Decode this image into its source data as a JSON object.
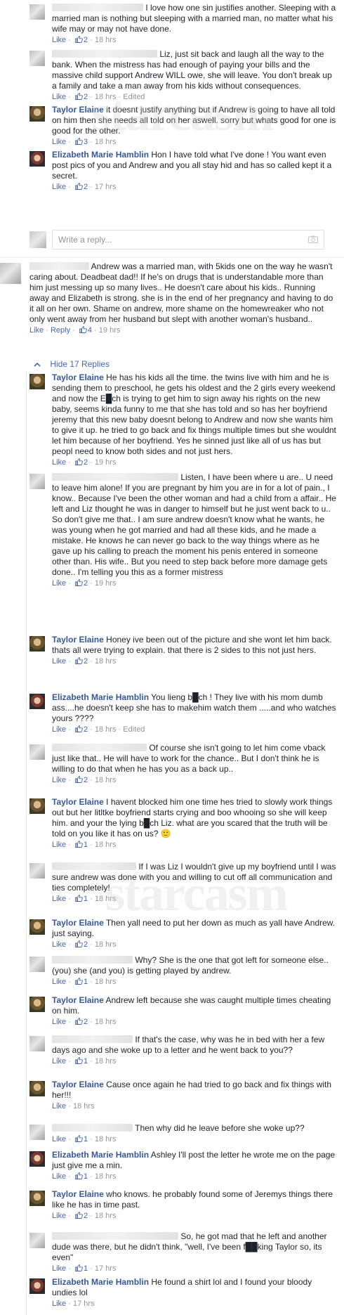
{
  "ui": {
    "like_label": "Like",
    "reply_label": "Reply",
    "edited_label": "Edited",
    "reply_placeholder": "Write a reply...",
    "hide_replies_label": "Hide 17 Replies",
    "watermark": "starcasm",
    "like_color": "#4267b2",
    "name_color": "#365899"
  },
  "comments": [
    {
      "author": "",
      "text": "I love how one sin justifies another. Sleeping with a married man is nothing but sleeping with a married man, no matter what his wife may or may not have done.",
      "likes": "2",
      "time": "18 hrs",
      "edited": false
    },
    {
      "author": "",
      "text": "Liz, just sit back and laugh all the way to the bank. When the mistress has had enough of paying your bills and the massive child support Andrew WILL owe, she will leave. You don't break up a family and take a man away from his kids without consequences.",
      "likes": "2",
      "time": "18 hrs",
      "edited": true
    },
    {
      "author": "Taylor Elaine",
      "text": "it doesnt justify anything but if Andrew is going to have all told on him then she needs all told on her aswell. sorry but whats good for one is good for the other.",
      "likes": "3",
      "time": "18 hrs",
      "edited": false
    },
    {
      "author": "Elizabeth Marie Hamblin",
      "text": "Hon I have told what I've done ! You want even post pics of you and Andrew and you all stay hid and has so called kept it a secret.",
      "likes": "2",
      "time": "17 hrs",
      "edited": false
    },
    {
      "author": "",
      "text": "Andrew was a married man, with 5kids one on the way he wasn't caring about. Deadbeat dad!! If he's on drugs that is understandable more than him just messing up so many lives.. He doesn't care about his kids.. Running away and Elizabeth is strong. she is in the end of her pregnancy and having to do it all on her own. Shame on andrew, more shame on the homewreaker who not only went away from her husband but slept with another woman's husband..",
      "likes": "4",
      "time": "19 hrs",
      "edited": false
    },
    {
      "author": "Taylor Elaine",
      "text": "He has his kids all the time. the twins live with him and he is sending them to preschool, he gets his oldest and the 2 girls every weekend and now the E█ch is trying to get him to sign away his rights on the new baby, seems kinda funny to me that she has told and so has her boyfriend jeremy that this new baby doesnt belong to Andrew and now she wants him to give it up. he tried to go back and fix things multiple times but she wouldnt let him because of her boyfriend. Yes he sinned just like all of us has but peopl need to know both sides and not just hers.",
      "likes": "2",
      "time": "19 hrs",
      "edited": false
    },
    {
      "author": "",
      "text": "Listen, I have been where u are.. U need to leave him alone! If you are pregnant by him you are in for a lot of pain., I know.. Because I've been the other woman and had a child from a affair.. He left and Liz thought he was in danger to himself but he just went back to u.. So don't give me that.. I am sure andrew doesn't know what he wants, he was young when he got married and had all these kids, and he made a mistake. He knows he can never go back to the way things where as he gave up his calling to preach the moment his penis entered in someone other than. His wife.. But you need to step back before more damage gets done.. I'm telling you this as a former mistress",
      "likes": "2",
      "time": "19 hrs",
      "edited": false
    },
    {
      "author": "Taylor Elaine",
      "text": "Honey ive been out of the picture and she wont let him back. thats all were trying to explain. that there is 2 sides to this not just hers.",
      "likes": "2",
      "time": "18 hrs",
      "edited": false
    },
    {
      "author": "Elizabeth Marie Hamblin",
      "text": "You lieng b█ch ! They live with his mom dumb ass....he doesn't keep she has to makehim watch them .....and who watches yours ????",
      "likes": "2",
      "time": "18 hrs",
      "edited": true
    },
    {
      "author": "",
      "text": "Of course she isn't going to let him come vback just like that.. He will have to work for the chance.. But I don't think he is willing to do that when he has you as a back up..",
      "likes": "2",
      "time": "18 hrs",
      "edited": false
    },
    {
      "author": "Taylor Elaine",
      "text": "I havent blocked him one time hes tried to slowly work things out but her litltke boyfriend starts crying and boo whooing so she will keep him. and your the lying b█ch Liz. what are you scared that the truth will be told on you like it has on us? 🙂",
      "likes": "1",
      "time": "18 hrs",
      "edited": false
    },
    {
      "author": "",
      "text": "If I was Liz I wouldn't give up my boyfriend until I was sure andrew was done with you and willing to cut off all communication and ties completely!",
      "likes": "1",
      "time": "18 hrs",
      "edited": false
    },
    {
      "author": "Taylor Elaine",
      "text": "Then yall need to put her down as much as yall have Andrew. just saying.",
      "likes": "2",
      "time": "18 hrs",
      "edited": false
    },
    {
      "author": "",
      "text": "Why? She is the one that got left for someone else..(you) she (and you) is getting played by andrew.",
      "likes": "1",
      "time": "18 hrs",
      "edited": false
    },
    {
      "author": "Taylor Elaine",
      "text": "Andrew left because she was caught multiple times cheating on him.",
      "likes": "2",
      "time": "18 hrs",
      "edited": false
    },
    {
      "author": "",
      "text": "If that's the case, why was he in bed with her a few days ago and she woke up to a letter and he went back to you??",
      "likes": "1",
      "time": "18 hrs",
      "edited": false
    },
    {
      "author": "Taylor Elaine",
      "text": "Cause once again he had tried to go back and fix things with her!!!",
      "likes": "",
      "time": "18 hrs",
      "edited": false
    },
    {
      "author": "",
      "text": "Then why did he leave before she woke up??",
      "likes": "1",
      "time": "18 hrs",
      "edited": false
    },
    {
      "author": "Elizabeth Marie Hamblin",
      "text": "Ashley I'll post the letter he wrote me on the page just give me a min.",
      "likes": "1",
      "time": "18 hrs",
      "edited": false
    },
    {
      "author": "Taylor Elaine",
      "text": "who knows. he probably found some of Jeremys things there like he has in time past.",
      "likes": "2",
      "time": "18 hrs",
      "edited": false
    },
    {
      "author": "",
      "text": "So, he got mad that he left and another dude was there, but he didn't think, \"well, I've been f██king Taylor so, its even\"",
      "likes": "1",
      "time": "17 hrs",
      "edited": false
    },
    {
      "author": "Elizabeth Marie Hamblin",
      "text": "He found a shirt lol and I found your bloody undies lol",
      "likes": "",
      "time": "17 hrs",
      "edited": false
    }
  ]
}
